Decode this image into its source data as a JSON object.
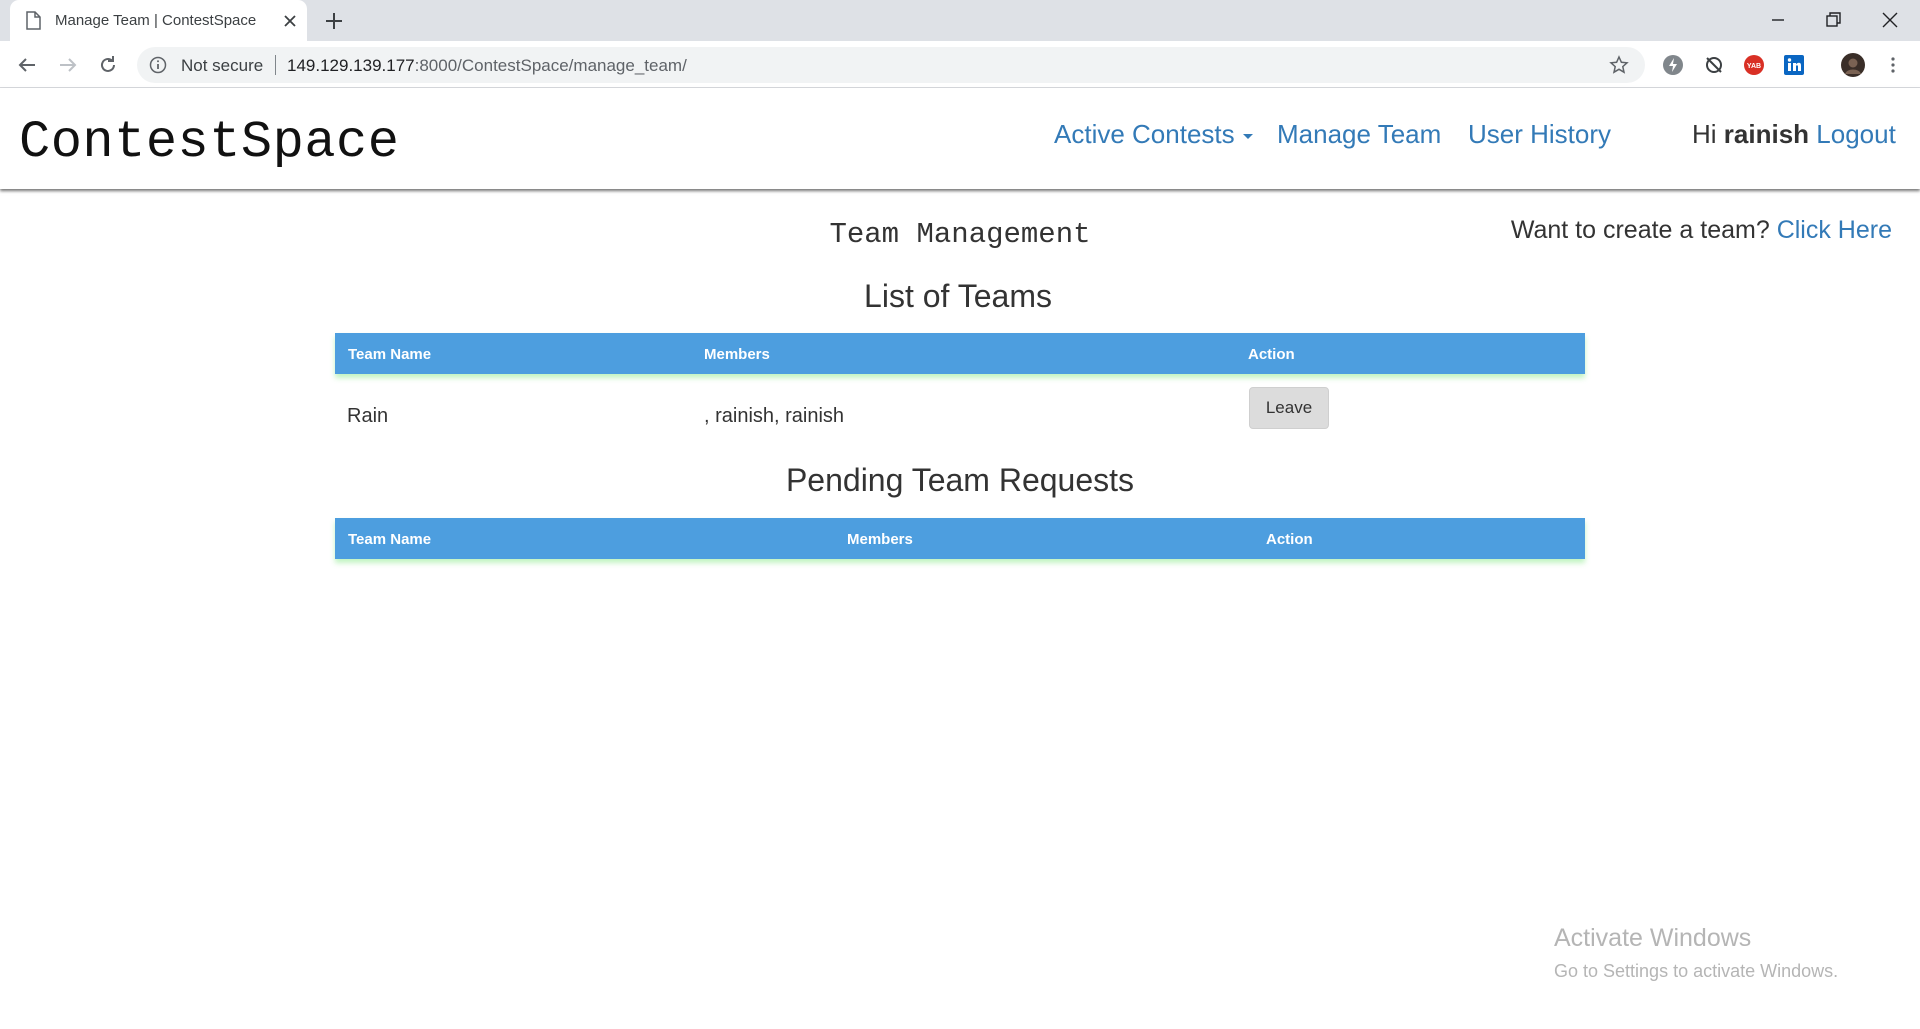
{
  "browser": {
    "tab_title": "Manage Team | ContestSpace",
    "security_label": "Not secure",
    "url_host": "149.129.139.177",
    "url_rest": ":8000/ContestSpace/manage_team/"
  },
  "nav": {
    "brand": "ContestSpace",
    "active_contests": "Active Contests",
    "manage_team": "Manage Team",
    "user_history": "User History",
    "greeting": "Hi",
    "username": "rainish",
    "logout": "Logout"
  },
  "page": {
    "heading": "Team Management",
    "create_prompt": "Want to create a team?",
    "create_link": "Click Here"
  },
  "teams": {
    "title": "List of Teams",
    "headers": [
      "Team Name",
      "Members",
      "Action"
    ],
    "rows": [
      {
        "team_name": "Rain",
        "members": ", rainish, rainish",
        "action": "Leave"
      }
    ]
  },
  "pending": {
    "title": "Pending Team Requests",
    "headers": [
      "Team Name",
      "Members",
      "Action"
    ]
  },
  "watermark": {
    "line1": "Activate Windows",
    "line2": "Go to Settings to activate Windows."
  },
  "colors": {
    "link": "#337ab7",
    "table_header": "#4d9edf",
    "button": "#dcdcdc"
  }
}
